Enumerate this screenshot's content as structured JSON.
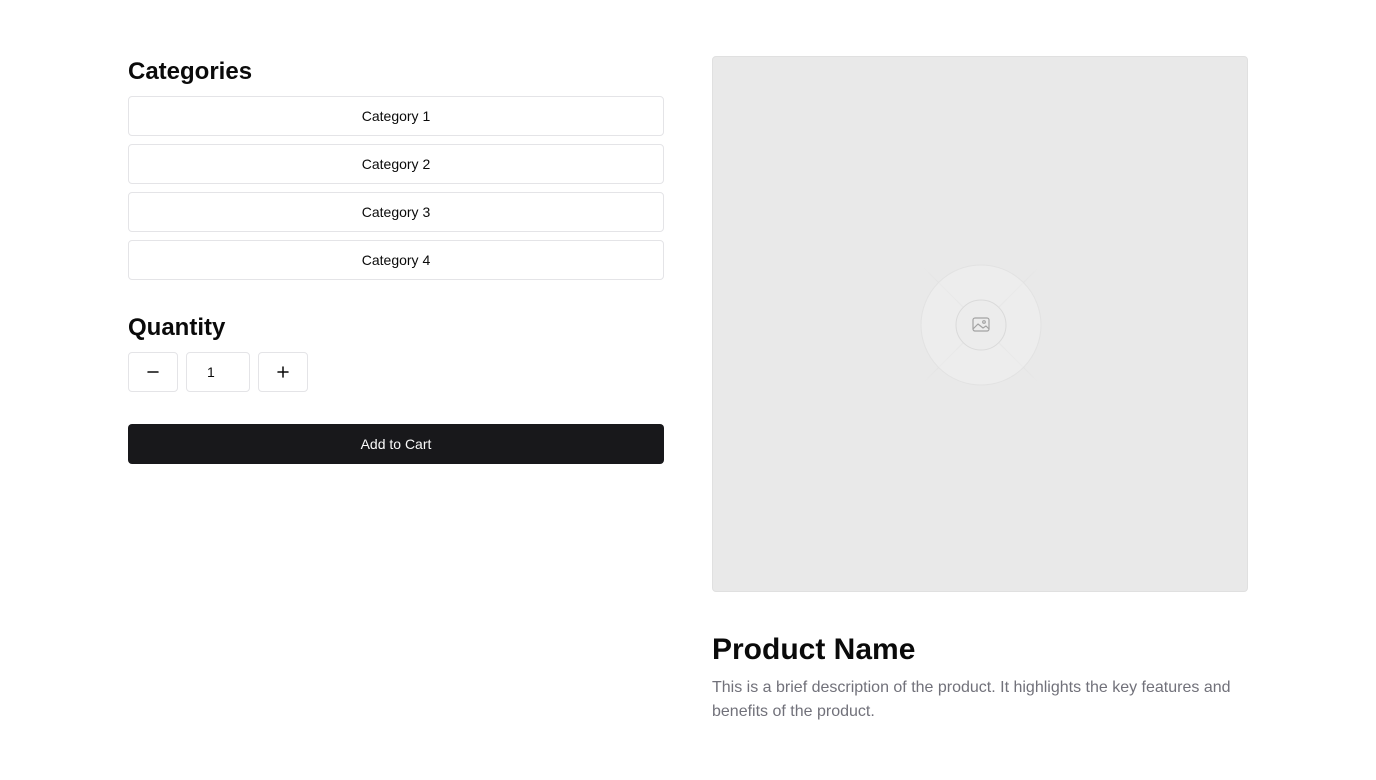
{
  "categories": {
    "title": "Categories",
    "items": [
      {
        "label": "Category 1"
      },
      {
        "label": "Category 2"
      },
      {
        "label": "Category 3"
      },
      {
        "label": "Category 4"
      }
    ]
  },
  "quantity": {
    "title": "Quantity",
    "value": "1",
    "decrement_icon": "minus-icon",
    "increment_icon": "plus-icon"
  },
  "cart": {
    "add_label": "Add to Cart"
  },
  "product": {
    "image_icon": "image-placeholder-icon",
    "name": "Product Name",
    "description": "This is a brief description of the product. It highlights the key features and benefits of the product."
  },
  "colors": {
    "primary_button": "#18181b",
    "border": "#e4e4e7",
    "image_bg": "#e9e9e9",
    "muted_text": "#71717a"
  }
}
